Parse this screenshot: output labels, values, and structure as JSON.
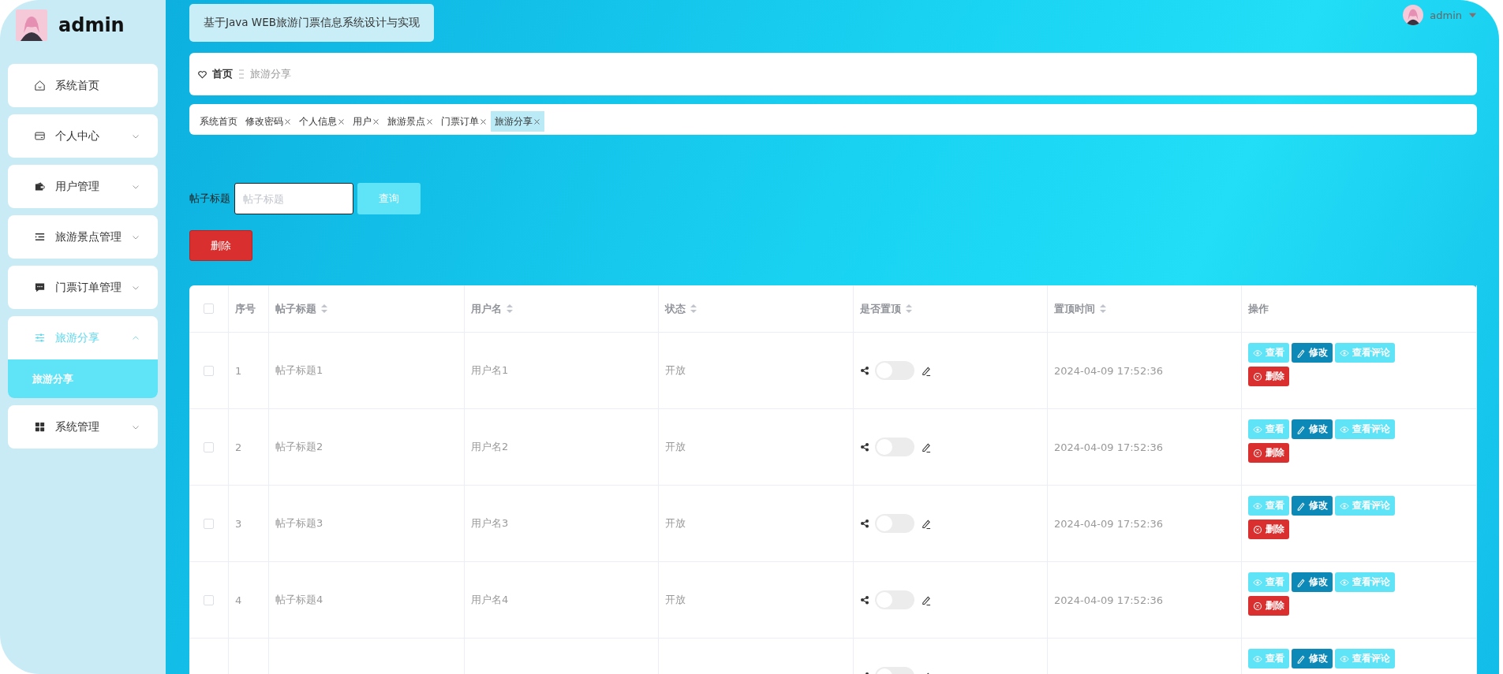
{
  "sidebar": {
    "user": "admin",
    "items": [
      {
        "label": "系统首页",
        "kind": "link"
      },
      {
        "label": "个人中心",
        "kind": "menu",
        "expanded": false
      },
      {
        "label": "用户管理",
        "kind": "menu",
        "expanded": false
      },
      {
        "label": "旅游景点管理",
        "kind": "menu",
        "expanded": false
      },
      {
        "label": "门票订单管理",
        "kind": "menu",
        "expanded": false
      },
      {
        "label": "旅游分享",
        "kind": "menu",
        "expanded": true,
        "children": [
          {
            "label": "旅游分享",
            "selected": true
          }
        ]
      },
      {
        "label": "系统管理",
        "kind": "menu",
        "expanded": false
      }
    ]
  },
  "header": {
    "title": "基于Java WEB旅游门票信息系统设计与实现",
    "user": "admin"
  },
  "breadcrumb": [
    "首页",
    "旅游分享"
  ],
  "tabs": [
    {
      "label": "系统首页",
      "selected": false,
      "closable": false
    },
    {
      "label": "修改密码",
      "selected": false,
      "closable": true
    },
    {
      "label": "个人信息",
      "selected": false,
      "closable": true
    },
    {
      "label": "用户",
      "selected": false,
      "closable": true
    },
    {
      "label": "旅游景点",
      "selected": false,
      "closable": true
    },
    {
      "label": "门票订单",
      "selected": false,
      "closable": true
    },
    {
      "label": "旅游分享",
      "selected": true,
      "closable": true
    }
  ],
  "search": {
    "label": "帖子标题",
    "placeholder": "帖子标题",
    "button": "查询"
  },
  "delete_button": "删除",
  "table": {
    "header_checked": false,
    "columns": [
      {
        "label": "序号",
        "sortable": false
      },
      {
        "label": "帖子标题",
        "sortable": true
      },
      {
        "label": "用户名",
        "sortable": true
      },
      {
        "label": "状态",
        "sortable": true
      },
      {
        "label": "是否置顶",
        "sortable": true
      },
      {
        "label": "置顶时间",
        "sortable": true
      },
      {
        "label": "操作",
        "sortable": false
      }
    ],
    "rows": [
      {
        "checked": false,
        "index": "1",
        "title": "帖子标题1",
        "user": "用户名1",
        "status": "开放",
        "pinned": false,
        "time": "2024-04-09 17:52:36",
        "actions": [
          {
            "label": "查看",
            "kind": "view"
          },
          {
            "label": "修改",
            "kind": "edit"
          },
          {
            "label": "查看评论",
            "kind": "comments"
          },
          {
            "label": "删除",
            "kind": "delete"
          }
        ]
      },
      {
        "checked": false,
        "index": "2",
        "title": "帖子标题2",
        "user": "用户名2",
        "status": "开放",
        "pinned": false,
        "time": "2024-04-09 17:52:36",
        "actions": [
          {
            "label": "查看",
            "kind": "view"
          },
          {
            "label": "修改",
            "kind": "edit"
          },
          {
            "label": "查看评论",
            "kind": "comments"
          },
          {
            "label": "删除",
            "kind": "delete"
          }
        ]
      },
      {
        "checked": false,
        "index": "3",
        "title": "帖子标题3",
        "user": "用户名3",
        "status": "开放",
        "pinned": false,
        "time": "2024-04-09 17:52:36",
        "actions": [
          {
            "label": "查看",
            "kind": "view"
          },
          {
            "label": "修改",
            "kind": "edit"
          },
          {
            "label": "查看评论",
            "kind": "comments"
          },
          {
            "label": "删除",
            "kind": "delete"
          }
        ]
      },
      {
        "checked": false,
        "index": "4",
        "title": "帖子标题4",
        "user": "用户名4",
        "status": "开放",
        "pinned": false,
        "time": "2024-04-09 17:52:36",
        "actions": [
          {
            "label": "查看",
            "kind": "view"
          },
          {
            "label": "修改",
            "kind": "edit"
          },
          {
            "label": "查看评论",
            "kind": "comments"
          },
          {
            "label": "删除",
            "kind": "delete"
          }
        ]
      },
      {
        "pinned": false,
        "actions": [
          {
            "label": "查看",
            "kind": "view"
          },
          {
            "label": "修改",
            "kind": "edit"
          },
          {
            "label": "查看评论",
            "kind": "comments"
          }
        ]
      }
    ]
  }
}
